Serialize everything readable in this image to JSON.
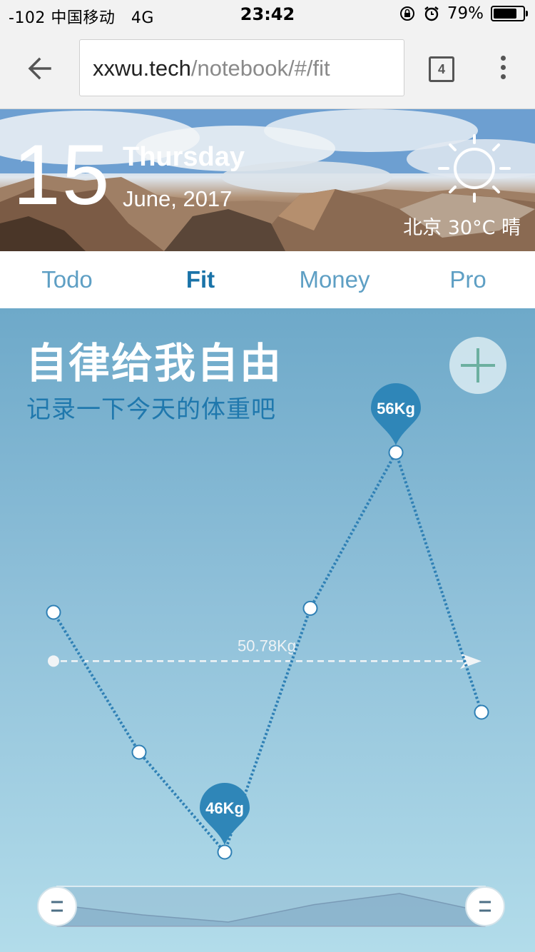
{
  "status_bar": {
    "carrier": "-102 中国移动",
    "network": "4G",
    "time": "23:42",
    "battery_text": "79%",
    "battery_level": 0.79
  },
  "browser": {
    "url_host": "xxwu.tech",
    "url_path": "/notebook/#/fit",
    "tab_count": "4"
  },
  "hero": {
    "day": "15",
    "weekday": "Thursday",
    "month_year": "June, 2017",
    "weather": "北京 30°C 晴",
    "weather_icon": "sun-icon"
  },
  "nav": {
    "tabs": [
      {
        "label": "Todo",
        "active": false
      },
      {
        "label": "Fit",
        "active": true
      },
      {
        "label": "Money",
        "active": false
      },
      {
        "label": "Pro",
        "active": false
      }
    ]
  },
  "fit": {
    "title": "自律给我自由",
    "subtitle": "记录一下今天的体重吧",
    "add_icon": "plus-icon"
  },
  "chart_data": {
    "type": "line",
    "title": "",
    "xlabel": "",
    "ylabel": "",
    "values": [
      52,
      48.5,
      46,
      52.1,
      56,
      49.5
    ],
    "ylim": [
      46,
      56
    ],
    "max_label": "56Kg",
    "min_label": "46Kg",
    "average": 50.78,
    "average_label": "50.78Kg",
    "colors": {
      "line": "#2f80b5",
      "marker_badge": "#2f86b8",
      "average_line": "#f1f4f6"
    }
  }
}
